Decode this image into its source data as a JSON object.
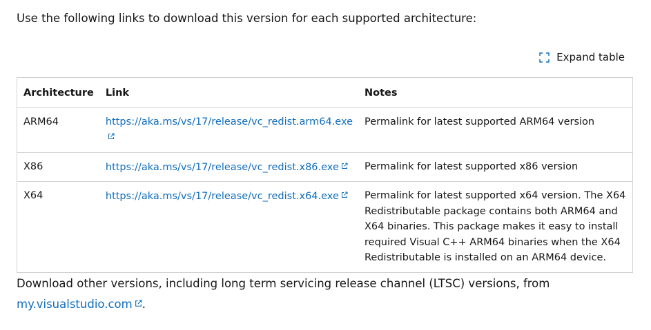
{
  "intro_text": "Use the following links to download this version for each supported architecture:",
  "expand_table": {
    "label": "Expand table",
    "icon": "expand-icon"
  },
  "table": {
    "headers": [
      "Architecture",
      "Link",
      "Notes"
    ],
    "rows": [
      {
        "architecture": "ARM64",
        "link": "https://aka.ms/vs/17/release/vc_redist.arm64.exe",
        "notes": "Permalink for latest supported ARM64 version"
      },
      {
        "architecture": "X86",
        "link": "https://aka.ms/vs/17/release/vc_redist.x86.exe",
        "notes": "Permalink for latest supported x86 version"
      },
      {
        "architecture": "X64",
        "link": "https://aka.ms/vs/17/release/vc_redist.x64.exe",
        "notes": "Permalink for latest supported x64 version. The X64 Redistributable package contains both ARM64 and X64 binaries. This package makes it easy to install required Visual C++ ARM64 binaries when the X64 Redistributable is installed on an ARM64 device."
      }
    ]
  },
  "footer": {
    "text": "Download other versions, including long term servicing release channel (LTSC) versions, from",
    "link_text": "my.visualstudio.com",
    "suffix": "."
  },
  "colors": {
    "link": "#0f6cbd",
    "text": "#161616",
    "border": "#d1d1d1"
  }
}
